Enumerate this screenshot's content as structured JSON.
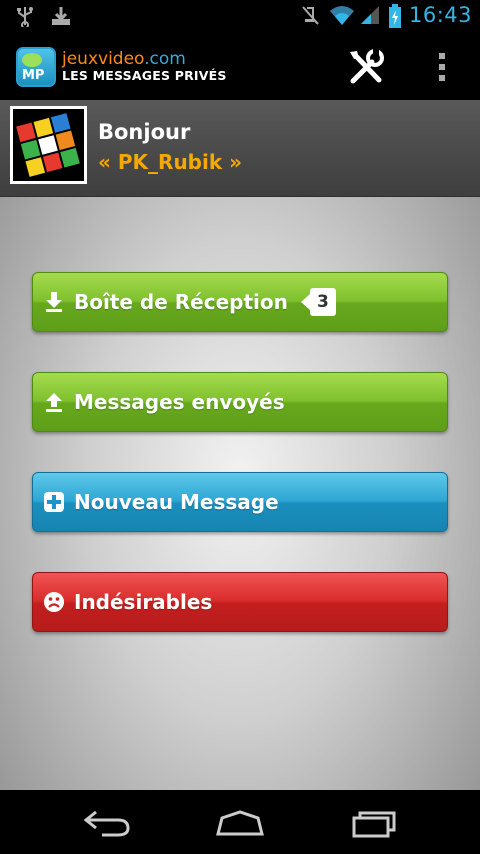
{
  "status_bar": {
    "time": "16:43",
    "icons": [
      "usb-icon",
      "download-icon",
      "mute-icon",
      "wifi-icon",
      "signal-icon",
      "battery-charging-icon"
    ]
  },
  "action_bar": {
    "brand_jv": "jeuxvideo",
    "brand_com": ".com",
    "subtitle": "LES MESSAGES PRIVÉS",
    "logo_text": "MP",
    "icons": [
      "tools-icon",
      "overflow-menu-icon"
    ]
  },
  "user": {
    "greeting": "Bonjour",
    "username": "« PK_Rubik »"
  },
  "menu": {
    "inbox": {
      "label": "Boîte de Réception",
      "badge": "3",
      "icon": "download-arrow-icon"
    },
    "sent": {
      "label": "Messages envoyés",
      "icon": "upload-arrow-icon"
    },
    "new": {
      "label": "Nouveau Message",
      "icon": "plus-icon"
    },
    "spam": {
      "label": "Indésirables",
      "icon": "sad-face-icon"
    }
  },
  "colors": {
    "green": "#7fc02e",
    "blue": "#2ea6d3",
    "red": "#d92c2c",
    "username": "#f5a800",
    "time": "#33b5e5"
  },
  "nav_bar": {
    "icons": [
      "back-icon",
      "home-icon",
      "recent-apps-icon"
    ]
  }
}
